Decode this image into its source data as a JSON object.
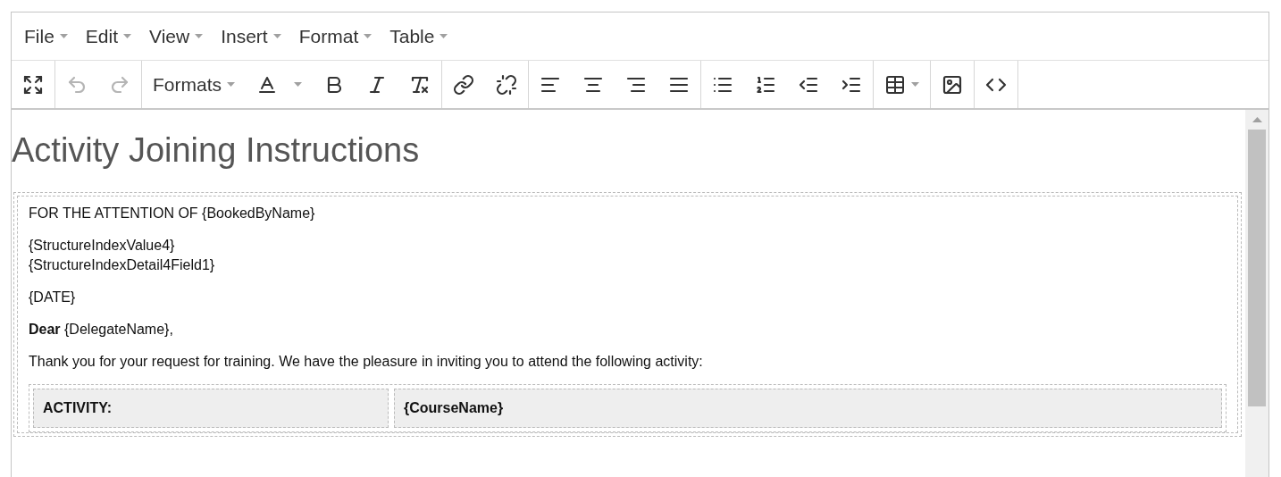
{
  "menu_bar": [
    {
      "label": "File"
    },
    {
      "label": "Edit"
    },
    {
      "label": "View"
    },
    {
      "label": "Insert"
    },
    {
      "label": "Format"
    },
    {
      "label": "Table"
    }
  ],
  "toolbar": {
    "undo": {
      "disabled": true
    },
    "redo": {
      "disabled": true
    },
    "formats": {
      "label": "Formats"
    }
  },
  "document": {
    "heading": "Activity Joining Instructions",
    "paragraphs": [
      {
        "lines": [
          "FOR THE ATTENTION OF {BookedByName}"
        ]
      },
      {
        "lines": [
          "{StructureIndexValue4}",
          "{StructureIndexDetail4Field1}"
        ]
      },
      {
        "lines": [
          "{DATE}"
        ]
      },
      {
        "lines": [
          "**Dear** {DelegateName},"
        ]
      },
      {
        "lines": [
          "Thank you for your request for training. We have the pleasure in inviting you to attend the following activity:"
        ]
      }
    ],
    "table": {
      "rows": [
        [
          "ACTIVITY:",
          "{CourseName}"
        ]
      ]
    }
  }
}
